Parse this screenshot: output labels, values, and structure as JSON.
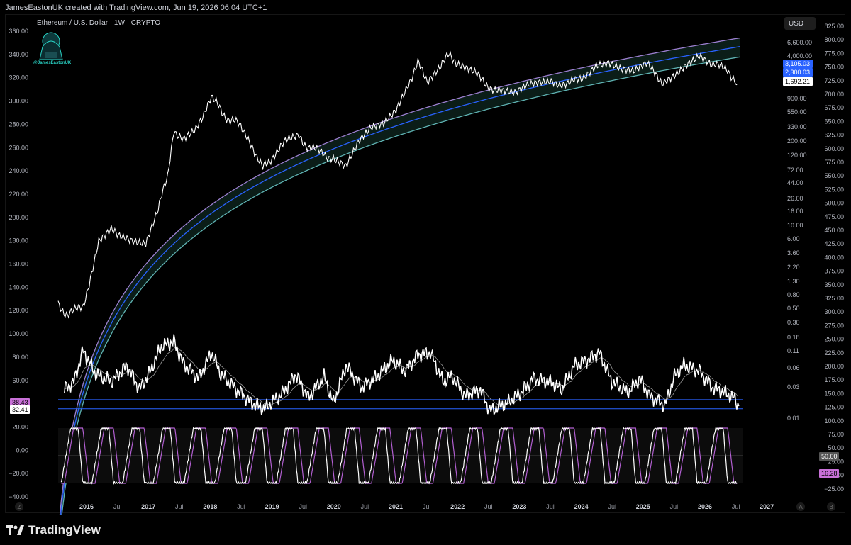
{
  "header": {
    "attribution": "JamesEastonUK created with TradingView.com, Jun 19, 2026 06:04 UTC+1"
  },
  "chart": {
    "title": "Ethereum / U.S. Dollar · 1W · CRYPTO",
    "currency_button": "USD",
    "mascot_label": "@JamesEastonUK"
  },
  "footer": {
    "logo_text": "TradingView"
  },
  "corner_buttons": {
    "left_bottom": "Z",
    "right_a": "A",
    "right_b": "B"
  },
  "colors": {
    "background": "#000000",
    "price": "#ffffff",
    "band_upper": "#9c7fd0",
    "band_mid": "#2962ff",
    "band_lower": "#5fb3b3",
    "band_fill": "#0f2a22",
    "rsi_level": "#2962ff",
    "stoch_k": "#ffffff",
    "stoch_d": "#b25fd1",
    "price_label_1": "#2962ff",
    "price_label_2": "#2962ff",
    "price_label_3": "#ffffff",
    "rsi_label_1": "#c971d8",
    "rsi_label_2": "#ffffff"
  },
  "chart_data": [
    {
      "type": "line",
      "name": "price",
      "y_scale": "log",
      "right_axis_ticks": [
        "6,600.00",
        "4,000.00",
        "900.00",
        "550.00",
        "330.00",
        "200.00",
        "120.00",
        "72.00",
        "44.00",
        "26.00",
        "16.00",
        "10.00",
        "6.00",
        "3.60",
        "2.20",
        "1.30",
        "0.80",
        "0.50",
        "0.30",
        "0.18",
        "0.11",
        "0.06",
        "0.03",
        "0.01"
      ],
      "outer_axis_ticks": [
        "825.00",
        "800.00",
        "775.00",
        "750.00",
        "725.00",
        "700.00",
        "675.00",
        "650.00",
        "625.00",
        "600.00",
        "575.00",
        "550.00",
        "525.00",
        "500.00",
        "475.00",
        "450.00",
        "425.00",
        "400.00",
        "375.00",
        "350.00",
        "325.00",
        "300.00",
        "275.00",
        "250.00",
        "225.00",
        "200.00",
        "175.00",
        "150.00",
        "125.00",
        "100.00",
        "75.00",
        "50.00",
        "25.00",
        "0.00",
        "−25.00"
      ],
      "left_axis_ticks": [
        "360.00",
        "340.00",
        "320.00",
        "300.00",
        "280.00",
        "260.00",
        "240.00",
        "220.00",
        "200.00",
        "180.00",
        "160.00",
        "140.00",
        "120.00",
        "100.00",
        "80.00",
        "60.00",
        "40.00",
        "20.00",
        "0.00",
        "−20.00",
        "−40.00"
      ],
      "x_tick_labels": [
        "2016",
        "Jul",
        "2017",
        "Jul",
        "2018",
        "Jul",
        "2019",
        "Jul",
        "2020",
        "Jul",
        "2021",
        "Jul",
        "2022",
        "Jul",
        "2023",
        "Jul",
        "2024",
        "Jul",
        "2025",
        "Jul",
        "2026",
        "Jul",
        "2027"
      ],
      "x": [
        2015.6,
        2015.75,
        2016.0,
        2016.25,
        2016.45,
        2016.6,
        2016.8,
        2017.0,
        2017.2,
        2017.35,
        2017.45,
        2017.6,
        2017.8,
        2017.95,
        2018.05,
        2018.2,
        2018.35,
        2018.5,
        2018.7,
        2018.87,
        2019.0,
        2019.25,
        2019.45,
        2019.6,
        2019.85,
        2020.0,
        2020.2,
        2020.4,
        2020.6,
        2020.8,
        2021.0,
        2021.2,
        2021.35,
        2021.5,
        2021.7,
        2021.85,
        2022.0,
        2022.2,
        2022.45,
        2022.7,
        2022.9,
        2023.1,
        2023.3,
        2023.5,
        2023.75,
        2024.0,
        2024.2,
        2024.4,
        2024.6,
        2024.8,
        2025.0,
        2025.25,
        2025.45,
        2025.65,
        2025.85,
        2026.05,
        2026.3,
        2026.45
      ],
      "y": [
        1.0,
        0.7,
        0.95,
        8,
        12,
        11,
        9,
        8,
        25,
        80,
        380,
        250,
        350,
        750,
        1200,
        700,
        500,
        460,
        220,
        100,
        140,
        250,
        300,
        200,
        170,
        130,
        100,
        230,
        380,
        450,
        730,
        1800,
        3500,
        2000,
        3300,
        4600,
        3500,
        2800,
        1700,
        1300,
        1200,
        1600,
        1800,
        1900,
        1700,
        2300,
        3500,
        3800,
        3000,
        2700,
        3400,
        1900,
        2500,
        3600,
        4700,
        3300,
        2900,
        1692.21
      ],
      "last_price_label": "1,692.21",
      "band_labels": [
        "3,105.03",
        "2,300.03"
      ]
    },
    {
      "type": "line",
      "name": "rsi",
      "x": [
        2015.7,
        2015.85,
        2016.0,
        2016.2,
        2016.45,
        2016.7,
        2016.9,
        2017.05,
        2017.25,
        2017.45,
        2017.6,
        2017.85,
        2018.05,
        2018.2,
        2018.45,
        2018.7,
        2018.9,
        2019.2,
        2019.4,
        2019.6,
        2019.85,
        2020.0,
        2020.2,
        2020.45,
        2020.7,
        2020.95,
        2021.15,
        2021.35,
        2021.55,
        2021.75,
        2021.9,
        2022.1,
        2022.35,
        2022.5,
        2022.8,
        2023.0,
        2023.2,
        2023.45,
        2023.65,
        2023.85,
        2024.05,
        2024.25,
        2024.45,
        2024.7,
        2024.9,
        2025.05,
        2025.3,
        2025.45,
        2025.6,
        2025.85,
        2026.05,
        2026.25,
        2026.4,
        2026.48
      ],
      "y": [
        48,
        55,
        84,
        62,
        55,
        70,
        48,
        62,
        88,
        92,
        72,
        58,
        82,
        62,
        48,
        35,
        30,
        45,
        62,
        40,
        60,
        35,
        70,
        50,
        60,
        75,
        65,
        80,
        82,
        55,
        60,
        42,
        48,
        28,
        36,
        45,
        58,
        55,
        48,
        70,
        75,
        82,
        55,
        45,
        58,
        42,
        33,
        60,
        70,
        65,
        50,
        45,
        40,
        32.41
      ],
      "levels": [
        38.43,
        30
      ],
      "labels": [
        "38.43",
        "32.41"
      ]
    },
    {
      "type": "line",
      "name": "stoch_rsi",
      "y_range": [
        0,
        100
      ],
      "labels": [
        "50.00",
        "16.28"
      ],
      "pattern_note_free": true,
      "k_cycles": 22,
      "last_value": 16.28
    }
  ]
}
